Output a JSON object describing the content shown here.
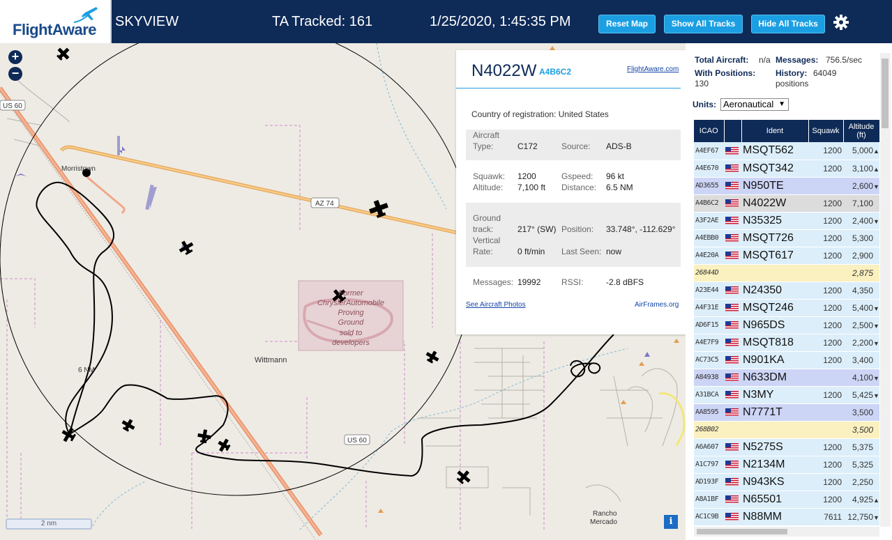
{
  "header": {
    "logo_text": "FlightAware",
    "app_name": "SKYVIEW",
    "tracked": "TA Tracked: 161",
    "datetime": "1/25/2020, 1:45:35 PM",
    "reset_label": "Reset Map",
    "show_label": "Show All Tracks",
    "hide_label": "Hide All Tracks",
    "settings_icon": "gear-icon",
    "colors": {
      "bar": "#0e2a57",
      "button": "#1b9fe2"
    }
  },
  "map": {
    "zoom_in": "+",
    "zoom_out": "−",
    "scale_label": "2 nm",
    "info_label": "i",
    "range_ring_label": "6 NM",
    "labels": {
      "us60_a": "US 60",
      "us60_b": "US 60",
      "az74": "AZ 74",
      "morristown": "Morristown",
      "wittmann": "Wittmann",
      "rancho": "Rancho",
      "mercado": "Mercado",
      "proving_1": "Former",
      "proving_2": "ChryslerAutomobile",
      "proving_3": "Proving",
      "proving_4": "Ground",
      "proving_5": "sold to",
      "proving_6": "developers"
    }
  },
  "popup": {
    "registration": "N4022W",
    "hex": "A4B6C2",
    "fa_link": "FlightAware.com",
    "country_label": "Country of registration:",
    "country": "United States",
    "aircraft_label_1": "Aircraft",
    "aircraft_label_2": "Type:",
    "aircraft_type": "C172",
    "source_label": "Source:",
    "source": "ADS-B",
    "squawk_label": "Squawk:",
    "squawk": "1200",
    "gspeed_label": "Gspeed:",
    "gspeed": "96 kt",
    "altitude_label": "Altitude:",
    "altitude": "7,100 ft",
    "distance_label": "Distance:",
    "distance": "6.5 NM",
    "track_label_1": "Ground",
    "track_label_2": "track:",
    "track": "217° (SW)",
    "position_label": "Position:",
    "position": "33.748°, -112.629°",
    "vrate_label_1": "Vertical",
    "vrate_label_2": "Rate:",
    "vrate": "0 ft/min",
    "lastseen_label": "Last Seen:",
    "lastseen": "now",
    "messages_label": "Messages:",
    "messages": "19992",
    "rssi_label": "RSSI:",
    "rssi": "-2.8 dBFS",
    "photos_link": "See Aircraft Photos",
    "airframes_link": "AirFrames.org"
  },
  "panel": {
    "total_label": "Total Aircraft:",
    "total": "n/a",
    "messages_label": "Messages:",
    "messages": "756.5/sec",
    "withpos_label": "With Positions:",
    "withpos": "130",
    "history_label": "History:",
    "history": "64049",
    "history_unit": "positions",
    "units_label": "Units:",
    "units_value": "Aeronautical",
    "columns": [
      "ICAO",
      "",
      "Ident",
      "Squawk",
      "Altitude (ft)"
    ],
    "rows": [
      {
        "icao": "A4EF67",
        "ident": "MSQT562",
        "squawk": "1200",
        "alt": "5,000",
        "trend": "▲",
        "style": "r",
        "flag": true
      },
      {
        "icao": "A4E670",
        "ident": "MSQT342",
        "squawk": "1200",
        "alt": "3,100",
        "trend": "▲",
        "style": "r",
        "flag": true
      },
      {
        "icao": "AD3655",
        "ident": "N950TE",
        "squawk": "",
        "alt": "2,600",
        "trend": "▼",
        "style": "s",
        "flag": true
      },
      {
        "icao": "A4B6C2",
        "ident": "N4022W",
        "squawk": "1200",
        "alt": "7,100",
        "trend": "",
        "style": "g",
        "flag": true
      },
      {
        "icao": "A3F2AE",
        "ident": "N35325",
        "squawk": "1200",
        "alt": "2,400",
        "trend": "▼",
        "style": "r",
        "flag": true
      },
      {
        "icao": "A4EBB0",
        "ident": "MSQT726",
        "squawk": "1200",
        "alt": "5,300",
        "trend": "",
        "style": "r",
        "flag": true
      },
      {
        "icao": "A4E20A",
        "ident": "MSQT617",
        "squawk": "1200",
        "alt": "2,900",
        "trend": "",
        "style": "r",
        "flag": true
      },
      {
        "icao": "26844D",
        "ident": "",
        "squawk": "",
        "alt": "2,875",
        "trend": "",
        "style": "y",
        "flag": false
      },
      {
        "icao": "A23E44",
        "ident": "N24350",
        "squawk": "1200",
        "alt": "4,350",
        "trend": "",
        "style": "r",
        "flag": true
      },
      {
        "icao": "A4F31E",
        "ident": "MSQT246",
        "squawk": "1200",
        "alt": "5,400",
        "trend": "▼",
        "style": "r",
        "flag": true
      },
      {
        "icao": "AD6F15",
        "ident": "N965DS",
        "squawk": "1200",
        "alt": "2,500",
        "trend": "▼",
        "style": "r",
        "flag": true
      },
      {
        "icao": "A4E7F9",
        "ident": "MSQT818",
        "squawk": "1200",
        "alt": "2,200",
        "trend": "▼",
        "style": "r",
        "flag": true
      },
      {
        "icao": "AC73C5",
        "ident": "N901KA",
        "squawk": "1200",
        "alt": "3,400",
        "trend": "",
        "style": "r",
        "flag": true
      },
      {
        "icao": "A84938",
        "ident": "N633DM",
        "squawk": "",
        "alt": "4,100",
        "trend": "▼",
        "style": "s",
        "flag": true
      },
      {
        "icao": "A31BCA",
        "ident": "N3MY",
        "squawk": "1200",
        "alt": "5,425",
        "trend": "▼",
        "style": "r",
        "flag": true
      },
      {
        "icao": "AA8595",
        "ident": "N7771T",
        "squawk": "",
        "alt": "3,500",
        "trend": "",
        "style": "s",
        "flag": true
      },
      {
        "icao": "268B02",
        "ident": "",
        "squawk": "",
        "alt": "3,500",
        "trend": "",
        "style": "y",
        "flag": false
      },
      {
        "icao": "A6A607",
        "ident": "N5275S",
        "squawk": "1200",
        "alt": "5,375",
        "trend": "",
        "style": "r",
        "flag": true
      },
      {
        "icao": "A1C797",
        "ident": "N2134M",
        "squawk": "1200",
        "alt": "5,325",
        "trend": "",
        "style": "r",
        "flag": true
      },
      {
        "icao": "AD193F",
        "ident": "N943KS",
        "squawk": "1200",
        "alt": "2,250",
        "trend": "",
        "style": "r",
        "flag": true
      },
      {
        "icao": "A8A1BF",
        "ident": "N65501",
        "squawk": "1200",
        "alt": "4,925",
        "trend": "▲",
        "style": "r",
        "flag": true
      },
      {
        "icao": "AC1C9B",
        "ident": "N88MM",
        "squawk": "7611",
        "alt": "12,750",
        "trend": "▼",
        "style": "r",
        "flag": true
      }
    ]
  }
}
